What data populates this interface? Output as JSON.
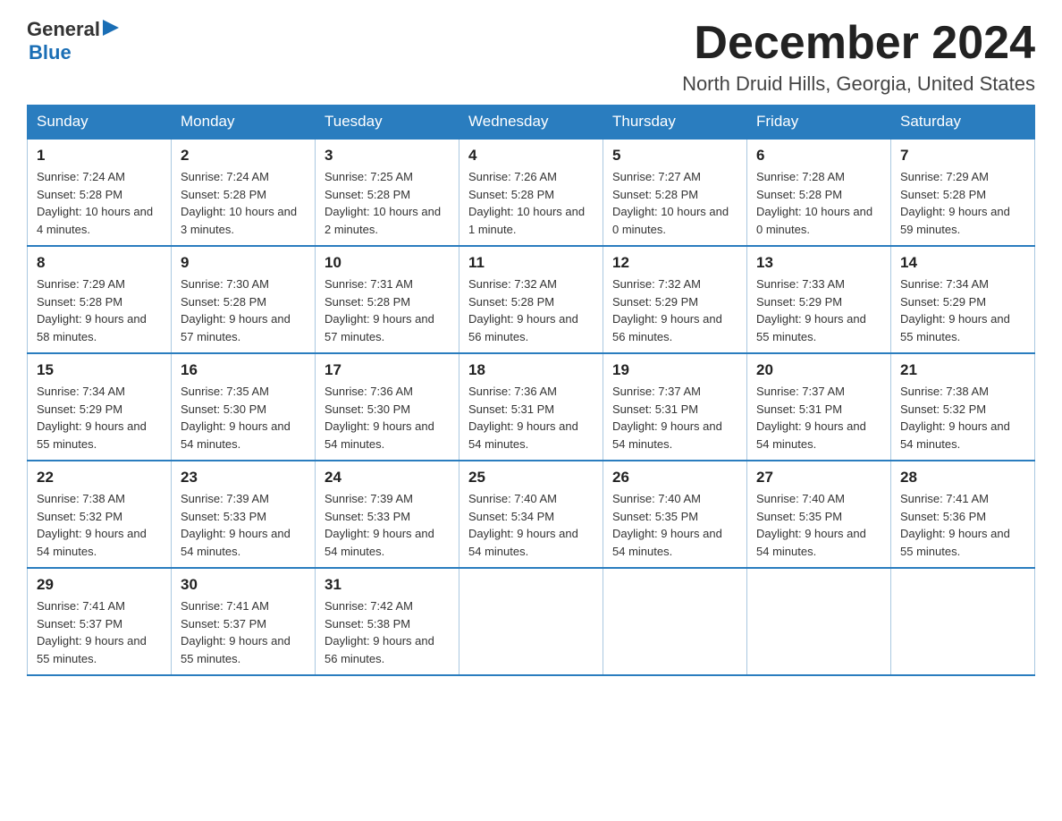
{
  "header": {
    "logo": {
      "general": "General",
      "blue": "Blue",
      "arrow": "▶"
    },
    "title": "December 2024",
    "location": "North Druid Hills, Georgia, United States"
  },
  "calendar": {
    "days_of_week": [
      "Sunday",
      "Monday",
      "Tuesday",
      "Wednesday",
      "Thursday",
      "Friday",
      "Saturday"
    ],
    "weeks": [
      [
        {
          "day": "1",
          "sunrise": "7:24 AM",
          "sunset": "5:28 PM",
          "daylight": "10 hours and 4 minutes."
        },
        {
          "day": "2",
          "sunrise": "7:24 AM",
          "sunset": "5:28 PM",
          "daylight": "10 hours and 3 minutes."
        },
        {
          "day": "3",
          "sunrise": "7:25 AM",
          "sunset": "5:28 PM",
          "daylight": "10 hours and 2 minutes."
        },
        {
          "day": "4",
          "sunrise": "7:26 AM",
          "sunset": "5:28 PM",
          "daylight": "10 hours and 1 minute."
        },
        {
          "day": "5",
          "sunrise": "7:27 AM",
          "sunset": "5:28 PM",
          "daylight": "10 hours and 0 minutes."
        },
        {
          "day": "6",
          "sunrise": "7:28 AM",
          "sunset": "5:28 PM",
          "daylight": "10 hours and 0 minutes."
        },
        {
          "day": "7",
          "sunrise": "7:29 AM",
          "sunset": "5:28 PM",
          "daylight": "9 hours and 59 minutes."
        }
      ],
      [
        {
          "day": "8",
          "sunrise": "7:29 AM",
          "sunset": "5:28 PM",
          "daylight": "9 hours and 58 minutes."
        },
        {
          "day": "9",
          "sunrise": "7:30 AM",
          "sunset": "5:28 PM",
          "daylight": "9 hours and 57 minutes."
        },
        {
          "day": "10",
          "sunrise": "7:31 AM",
          "sunset": "5:28 PM",
          "daylight": "9 hours and 57 minutes."
        },
        {
          "day": "11",
          "sunrise": "7:32 AM",
          "sunset": "5:28 PM",
          "daylight": "9 hours and 56 minutes."
        },
        {
          "day": "12",
          "sunrise": "7:32 AM",
          "sunset": "5:29 PM",
          "daylight": "9 hours and 56 minutes."
        },
        {
          "day": "13",
          "sunrise": "7:33 AM",
          "sunset": "5:29 PM",
          "daylight": "9 hours and 55 minutes."
        },
        {
          "day": "14",
          "sunrise": "7:34 AM",
          "sunset": "5:29 PM",
          "daylight": "9 hours and 55 minutes."
        }
      ],
      [
        {
          "day": "15",
          "sunrise": "7:34 AM",
          "sunset": "5:29 PM",
          "daylight": "9 hours and 55 minutes."
        },
        {
          "day": "16",
          "sunrise": "7:35 AM",
          "sunset": "5:30 PM",
          "daylight": "9 hours and 54 minutes."
        },
        {
          "day": "17",
          "sunrise": "7:36 AM",
          "sunset": "5:30 PM",
          "daylight": "9 hours and 54 minutes."
        },
        {
          "day": "18",
          "sunrise": "7:36 AM",
          "sunset": "5:31 PM",
          "daylight": "9 hours and 54 minutes."
        },
        {
          "day": "19",
          "sunrise": "7:37 AM",
          "sunset": "5:31 PM",
          "daylight": "9 hours and 54 minutes."
        },
        {
          "day": "20",
          "sunrise": "7:37 AM",
          "sunset": "5:31 PM",
          "daylight": "9 hours and 54 minutes."
        },
        {
          "day": "21",
          "sunrise": "7:38 AM",
          "sunset": "5:32 PM",
          "daylight": "9 hours and 54 minutes."
        }
      ],
      [
        {
          "day": "22",
          "sunrise": "7:38 AM",
          "sunset": "5:32 PM",
          "daylight": "9 hours and 54 minutes."
        },
        {
          "day": "23",
          "sunrise": "7:39 AM",
          "sunset": "5:33 PM",
          "daylight": "9 hours and 54 minutes."
        },
        {
          "day": "24",
          "sunrise": "7:39 AM",
          "sunset": "5:33 PM",
          "daylight": "9 hours and 54 minutes."
        },
        {
          "day": "25",
          "sunrise": "7:40 AM",
          "sunset": "5:34 PM",
          "daylight": "9 hours and 54 minutes."
        },
        {
          "day": "26",
          "sunrise": "7:40 AM",
          "sunset": "5:35 PM",
          "daylight": "9 hours and 54 minutes."
        },
        {
          "day": "27",
          "sunrise": "7:40 AM",
          "sunset": "5:35 PM",
          "daylight": "9 hours and 54 minutes."
        },
        {
          "day": "28",
          "sunrise": "7:41 AM",
          "sunset": "5:36 PM",
          "daylight": "9 hours and 55 minutes."
        }
      ],
      [
        {
          "day": "29",
          "sunrise": "7:41 AM",
          "sunset": "5:37 PM",
          "daylight": "9 hours and 55 minutes."
        },
        {
          "day": "30",
          "sunrise": "7:41 AM",
          "sunset": "5:37 PM",
          "daylight": "9 hours and 55 minutes."
        },
        {
          "day": "31",
          "sunrise": "7:42 AM",
          "sunset": "5:38 PM",
          "daylight": "9 hours and 56 minutes."
        },
        null,
        null,
        null,
        null
      ]
    ]
  }
}
